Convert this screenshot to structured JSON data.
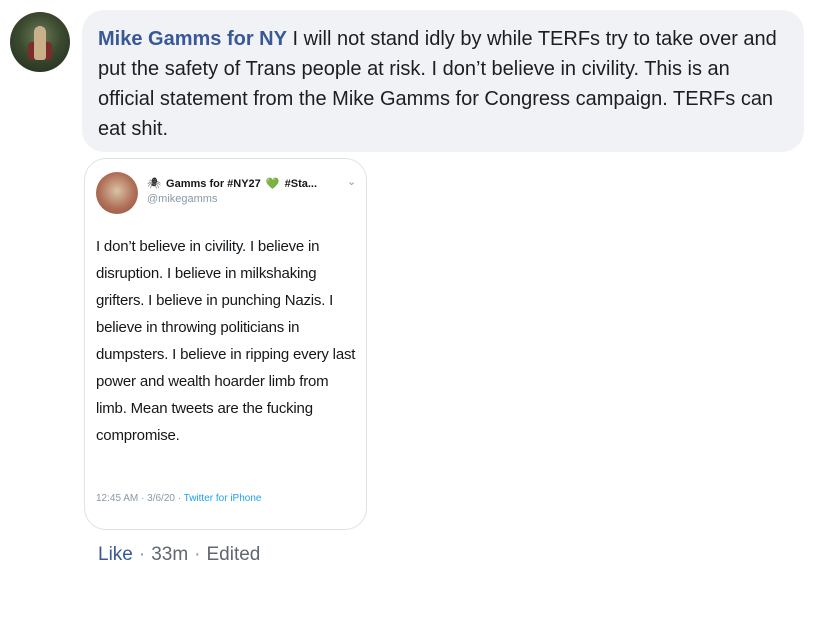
{
  "comment": {
    "author": "Mike Gamms for NY",
    "text": "I will not stand idly by while TERFs try to take over and put the safety of Trans people at risk. I don’t believe in civility. This is an official statement from the Mike Gamms for Congress campaign. TERFs can eat shit."
  },
  "tweet": {
    "display_name_prefix": "Gamms for #NY27",
    "display_name_suffix": "#Sta...",
    "spider_glyph": "🕷",
    "heart_glyph": "💚",
    "handle": "@mikegamms",
    "chevron": "⌄",
    "body": "I don’t believe in civility. I believe in disruption. I believe in milkshaking grifters. I believe in punching Nazis. I believe in throwing politicians in dumpsters. I believe in ripping every last power and wealth hoarder limb from limb. Mean tweets are the fucking compromise.",
    "timestamp": "12:45 AM · 3/6/20 · ",
    "source": "Twitter for iPhone"
  },
  "actions": {
    "like": "Like",
    "sep1": "·",
    "time": "33m",
    "sep2": "·",
    "edited": "Edited"
  },
  "colors": {
    "author_link": "#385898",
    "bubble_bg": "#f0f2f5",
    "twitter_blue": "#1da1f2",
    "muted_text": "#606770"
  },
  "icons": {
    "commenter_avatar": "avatar",
    "tweet_avatar": "avatar",
    "tweet_menu": "chevron-down-icon"
  }
}
